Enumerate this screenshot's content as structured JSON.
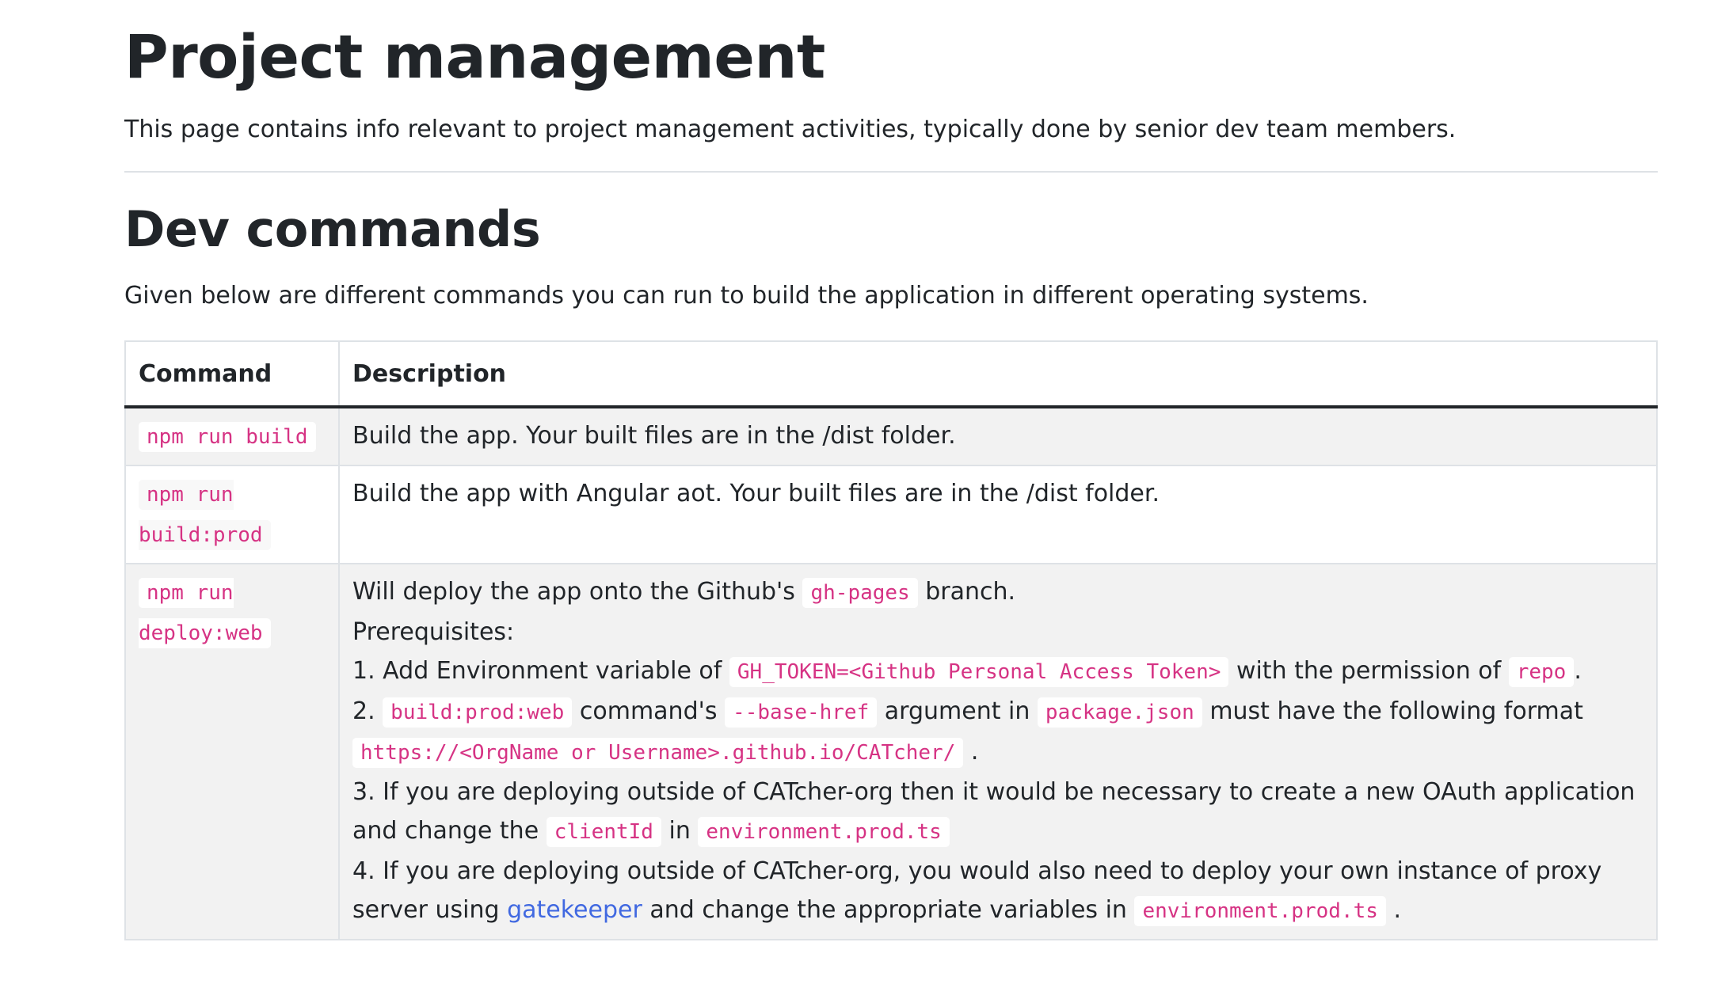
{
  "title": "Project management",
  "intro": "This page contains info relevant to project management activities, typically done by senior dev team members.",
  "section_title": "Dev commands",
  "section_lead": "Given below are different commands you can run to build the application in different operating systems.",
  "table": {
    "headers": [
      "Command",
      "Description"
    ],
    "rows": [
      {
        "command": "npm run build",
        "description": "Build the app. Your built files are in the /dist folder."
      },
      {
        "command": "npm run build:prod",
        "description": "Build the app with Angular aot. Your built files are in the /dist folder."
      },
      {
        "command": "npm run deploy:web",
        "line1_pre": "Will deploy the app onto the Github's",
        "line1_code": "gh-pages",
        "line1_post": "branch.",
        "prereq": "Prerequisites:",
        "item1_pre": "1. Add Environment variable of",
        "item1_code": "GH_TOKEN=<Github Personal Access Token>",
        "item1_mid": "with the permission of",
        "item1_code2": "repo",
        "item1_post": ".",
        "item2_pre": "2.",
        "item2_code1": "build:prod:web",
        "item2_mid1": "command's",
        "item2_code2": "--base-href",
        "item2_mid2": "argument in",
        "item2_code3": "package.json",
        "item2_mid3": "must have the following format",
        "item2_code4": "https://<OrgName or Username>.github.io/CATcher/",
        "item2_post": ".",
        "item3_pre": "3. If you are deploying outside of CATcher-org then it would be necessary to create a new OAuth application and change the",
        "item3_code1": "clientId",
        "item3_mid": "in",
        "item3_code2": "environment.prod.ts",
        "item4_pre": "4. If you are deploying outside of CATcher-org, you would also need to deploy your own instance of proxy server using",
        "item4_link": "gatekeeper",
        "item4_mid": "and change the appropriate variables in",
        "item4_code": "environment.prod.ts",
        "item4_post": "."
      }
    ]
  },
  "colors": {
    "text": "#212529",
    "code": "#d63384",
    "link": "#4169e1",
    "stripe": "#f2f2f2"
  }
}
